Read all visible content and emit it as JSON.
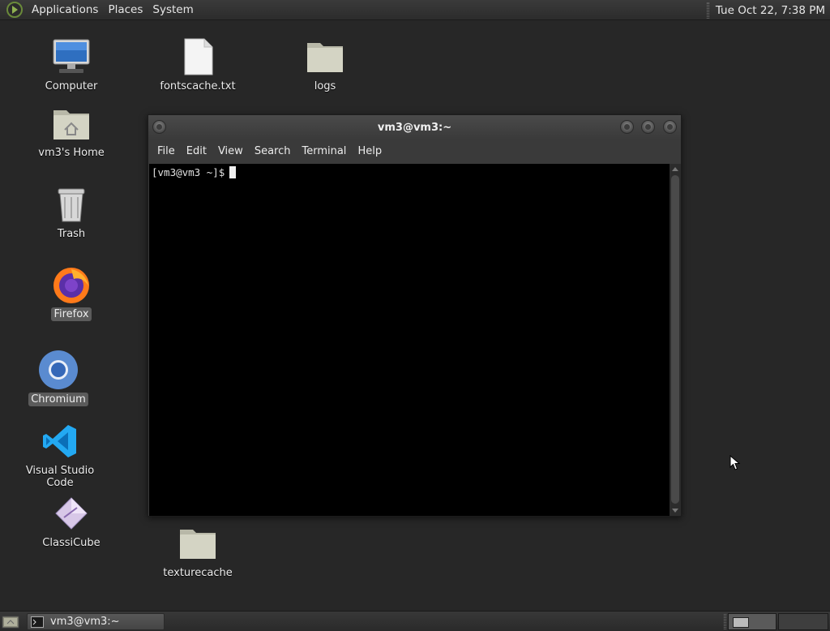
{
  "top_panel": {
    "menus": [
      "Applications",
      "Places",
      "System"
    ],
    "clock": "Tue Oct 22,  7:38 PM"
  },
  "desktop_icons": {
    "computer": "Computer",
    "home": "vm3's Home",
    "trash": "Trash",
    "firefox": "Firefox",
    "chromium": "Chromium",
    "vscode": "Visual Studio Code",
    "classicube": "ClassiCube",
    "fontscache": "fontscache.txt",
    "logs": "logs",
    "texturecache": "texturecache"
  },
  "terminal": {
    "title": "vm3@vm3:~",
    "menus": [
      "File",
      "Edit",
      "View",
      "Search",
      "Terminal",
      "Help"
    ],
    "prompt": "[vm3@vm3 ~]$"
  },
  "taskbar": {
    "window_label": "vm3@vm3:~"
  },
  "colors": {
    "desktop_bg": "#272727",
    "panel_bg": "#2f2f2f",
    "terminal_bg": "#000000"
  }
}
